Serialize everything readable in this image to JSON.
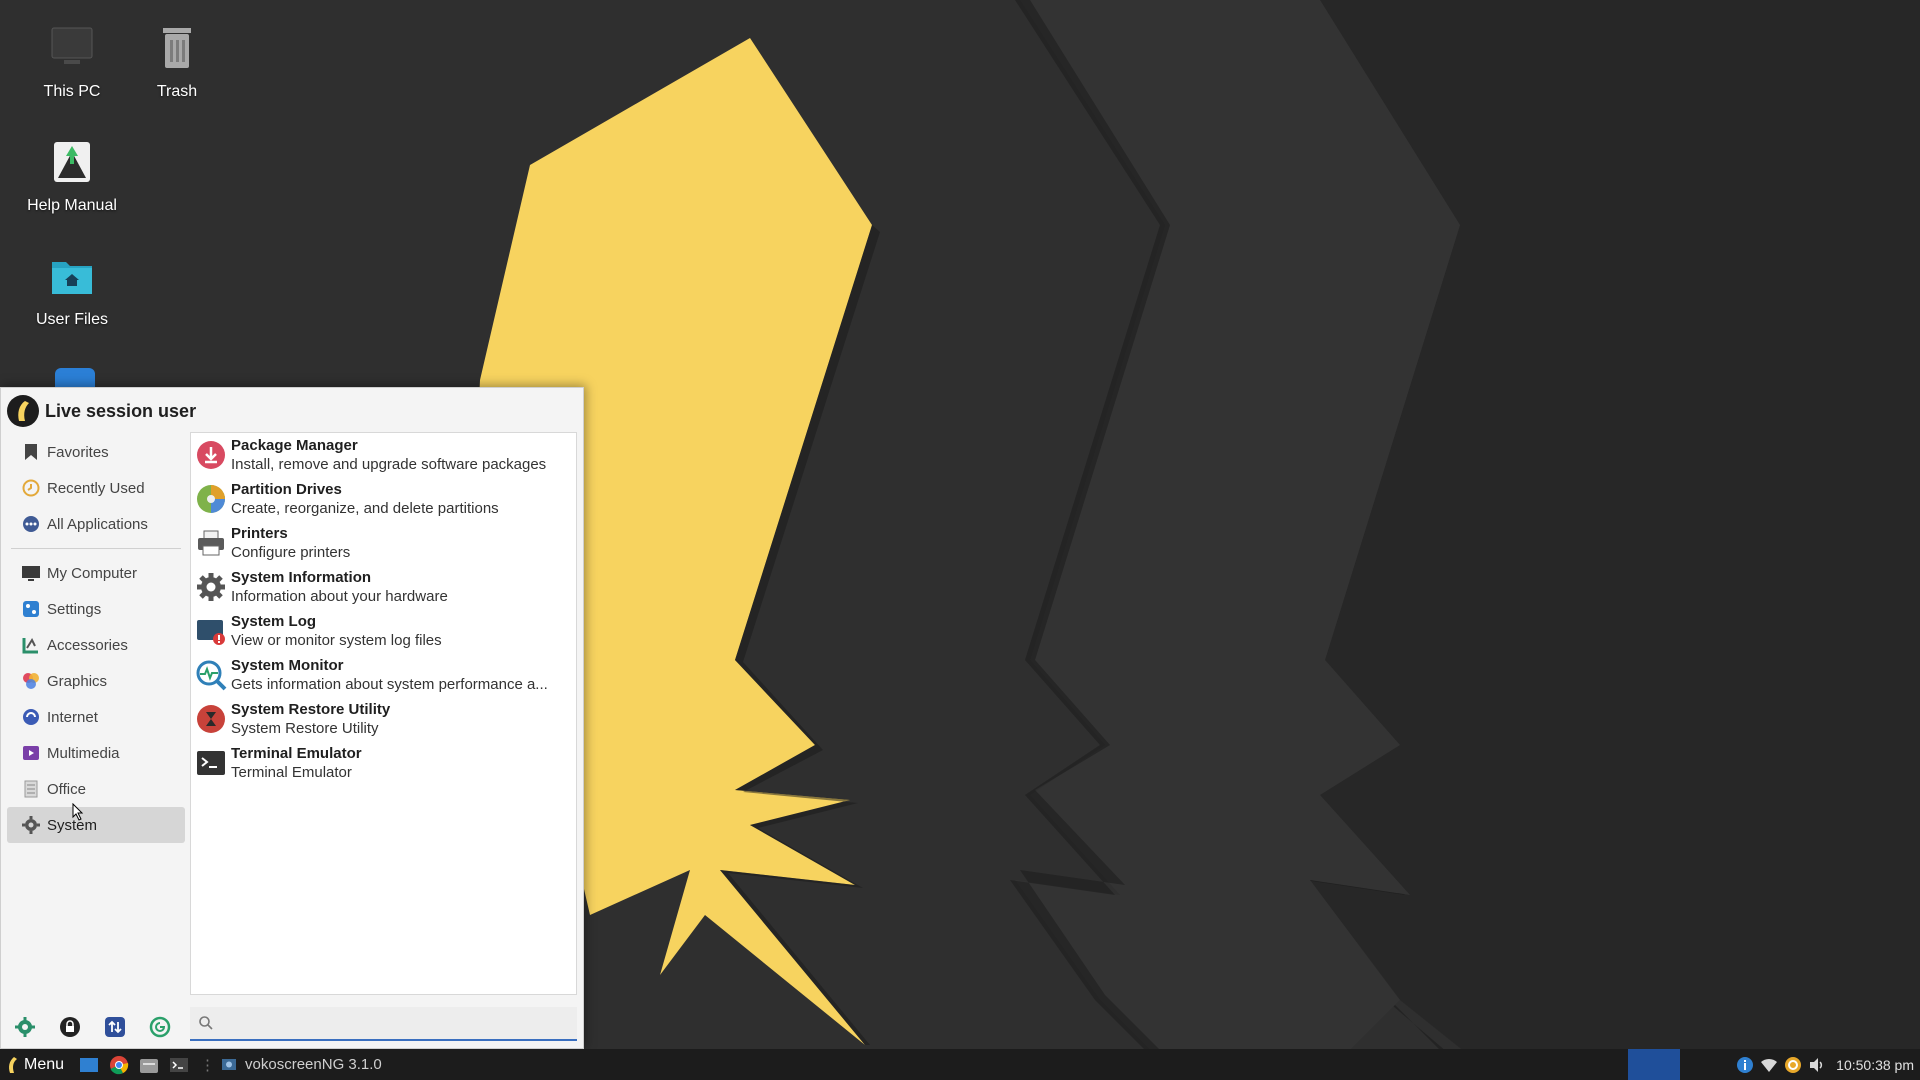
{
  "desktop": {
    "icons": [
      {
        "label": "This PC",
        "icon": "monitor-icon"
      },
      {
        "label": "Trash",
        "icon": "trash-icon"
      },
      {
        "label": "Help Manual",
        "icon": "help-manual-icon"
      },
      {
        "label": "User Files",
        "icon": "home-folder-icon"
      }
    ]
  },
  "menu": {
    "user_name": "Live session user",
    "categories": [
      {
        "label": "Favorites",
        "icon": "bookmark-icon"
      },
      {
        "label": "Recently Used",
        "icon": "clock-icon"
      },
      {
        "label": "All Applications",
        "icon": "apps-icon"
      },
      {
        "label": "My Computer",
        "icon": "monitor-icon"
      },
      {
        "label": "Settings",
        "icon": "settings-icon"
      },
      {
        "label": "Accessories",
        "icon": "accessories-icon"
      },
      {
        "label": "Graphics",
        "icon": "graphics-icon"
      },
      {
        "label": "Internet",
        "icon": "internet-icon"
      },
      {
        "label": "Multimedia",
        "icon": "multimedia-icon"
      },
      {
        "label": "Office",
        "icon": "office-icon"
      },
      {
        "label": "System",
        "icon": "system-gear-icon"
      }
    ],
    "active_category": "System",
    "apps": [
      {
        "name": "Package Manager",
        "desc": "Install, remove and upgrade software packages",
        "icon": "package-manager-icon"
      },
      {
        "name": "Partition Drives",
        "desc": "Create, reorganize, and delete partitions",
        "icon": "partition-icon"
      },
      {
        "name": "Printers",
        "desc": "Configure printers",
        "icon": "printer-icon"
      },
      {
        "name": "System Information",
        "desc": "Information about your hardware",
        "icon": "gear-icon"
      },
      {
        "name": "System Log",
        "desc": "View or monitor system log files",
        "icon": "system-log-icon"
      },
      {
        "name": "System Monitor",
        "desc": "Gets information about system performance a...",
        "icon": "system-monitor-icon"
      },
      {
        "name": "System Restore Utility",
        "desc": "System Restore Utility",
        "icon": "restore-icon"
      },
      {
        "name": "Terminal Emulator",
        "desc": "Terminal Emulator",
        "icon": "terminal-icon"
      }
    ],
    "footer_buttons": [
      "software-icon",
      "lock-icon",
      "switch-user-icon",
      "logout-icon"
    ],
    "search": {
      "value": "",
      "placeholder": ""
    }
  },
  "taskbar": {
    "menu_label": "Menu",
    "task_label": "vokoscreenNG 3.1.0",
    "clock": "10:50:38 pm"
  },
  "colors": {
    "wallpaper_bg": "#2e2e2e",
    "accent_yellow": "#f7d35f",
    "taskbar_bg": "#1c1c1c",
    "workspace_active": "#1f4f9a"
  }
}
